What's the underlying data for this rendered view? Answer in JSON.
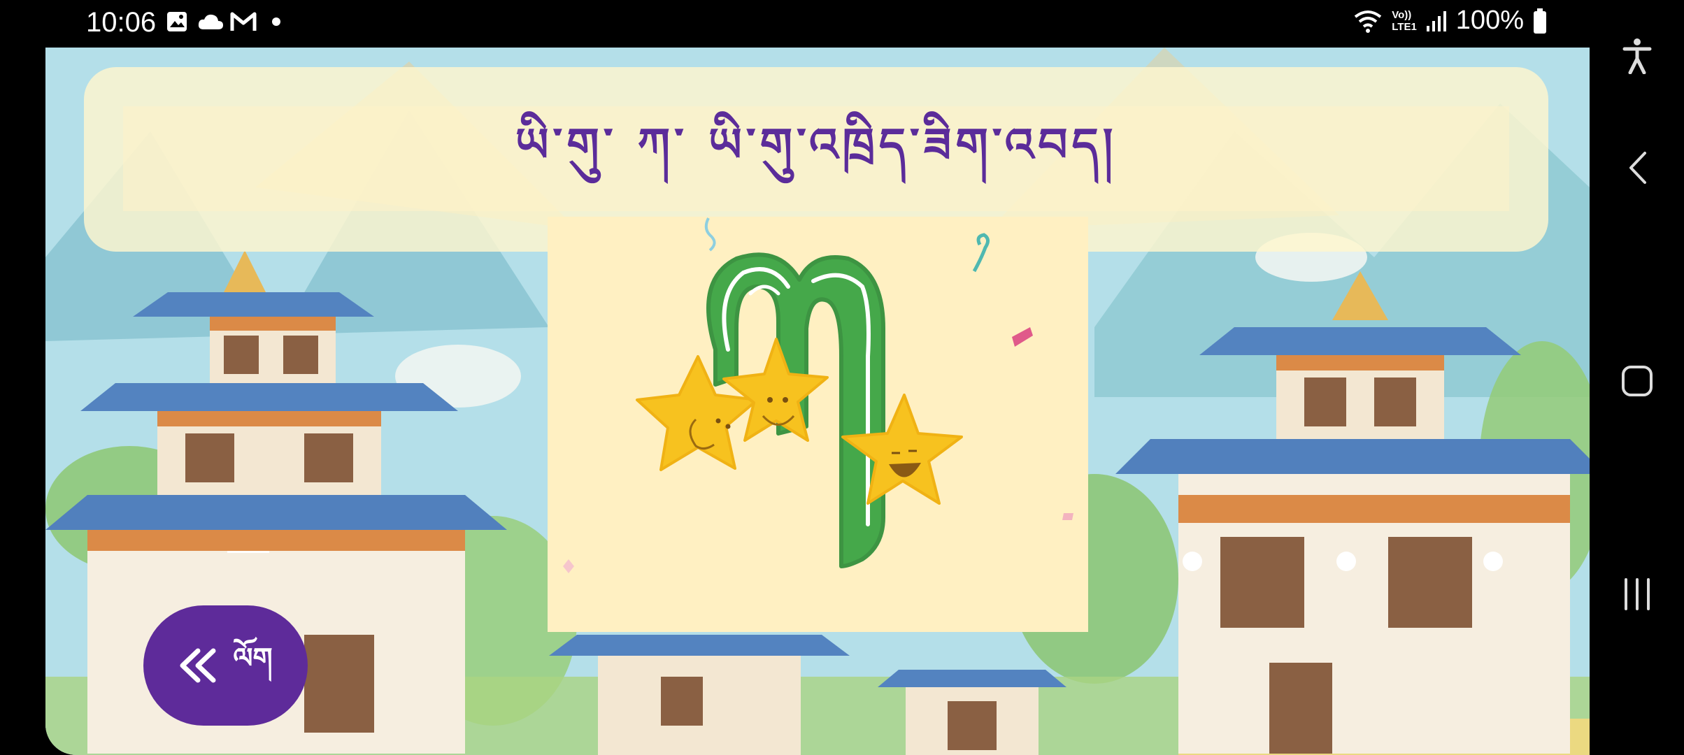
{
  "status_bar": {
    "time": "10:06",
    "battery": "100%",
    "left_icons": [
      "gallery-icon",
      "cloud-icon",
      "gmail-icon",
      "dot-icon"
    ],
    "right_icons": [
      "wifi-icon",
      "volte-icon",
      "signal-icon",
      "battery-icon"
    ],
    "network_label_top": "Vo))",
    "network_label_bottom": "LTE1"
  },
  "header": {
    "title": "ཡི་གུ་ ཀ་ ཡི་གུ་འཁྲིད་ཟིག་འབད།"
  },
  "card": {
    "illustration": "letter-ka-with-stars",
    "letter_color": "#45a84a",
    "star_color": "#f7c21f"
  },
  "back_button": {
    "label": "ལོག",
    "icon": "double-chevron-left-icon"
  },
  "nav": [
    "accessibility-icon",
    "back-icon",
    "home-icon",
    "recents-icon"
  ],
  "colors": {
    "accent": "#5e2b9a",
    "panel": "#fff6ce",
    "card": "#fff0c2"
  }
}
